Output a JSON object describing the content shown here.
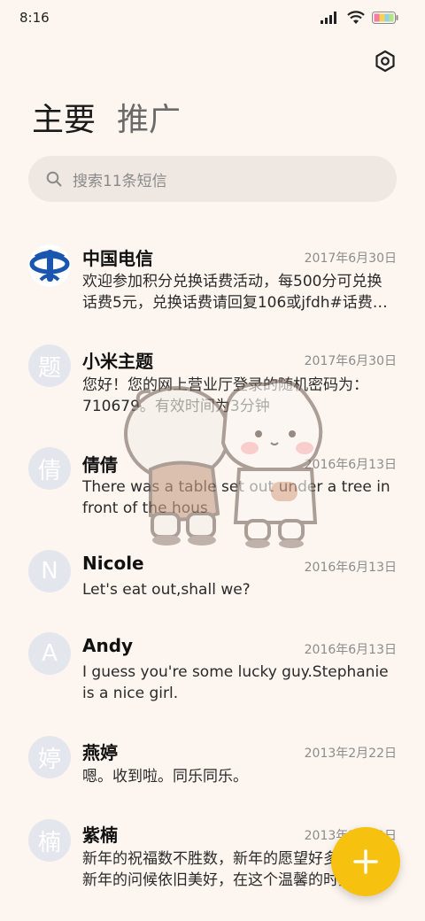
{
  "status_bar": {
    "time": "8:16",
    "icons": [
      "signal-icon",
      "wifi-icon",
      "battery-icon"
    ]
  },
  "header": {
    "settings_icon": "settings-hexagon-icon"
  },
  "tabs": [
    {
      "label": "主要",
      "active": true
    },
    {
      "label": "推广",
      "active": false
    }
  ],
  "search": {
    "placeholder": "搜索11条短信",
    "icon": "search-icon"
  },
  "messages": [
    {
      "avatar_text": "",
      "avatar_icon": "china-telecom-logo",
      "name": "中国电信",
      "date": "2017年6月30日",
      "preview": [
        "欢迎参加积分兑换话费活动，每500分可兑换",
        "话费5元，兑换话费请回复106或jfdh#话费…"
      ]
    },
    {
      "avatar_text": "题",
      "name": "小米主题",
      "date": "2017年6月30日",
      "preview": [
        "您好！您的网上营业厅登录的随机密码为：",
        "710679。有效时间为3分钟"
      ]
    },
    {
      "avatar_text": "倩",
      "name": "倩倩",
      "date": "2016年6月13日",
      "preview": [
        "There was a table set out under a tree in",
        "front of the hous"
      ]
    },
    {
      "avatar_text": "N",
      "name": "Nicole",
      "date": "2016年6月13日",
      "preview": [
        "Let's eat out,shall we?"
      ]
    },
    {
      "avatar_text": "A",
      "name": "Andy",
      "date": "2016年6月13日",
      "preview": [
        "I guess you're some lucky guy.Stephanie",
        "is a nice girl."
      ]
    },
    {
      "avatar_text": "婷",
      "name": "燕婷",
      "date": "2013年2月22日",
      "preview": [
        "嗯。收到啦。同乐同乐。"
      ]
    },
    {
      "avatar_text": "楠",
      "name": "紫楠",
      "date": "2013年2月22日",
      "preview": [
        "新年的祝福数不胜数，新年的愿望好多好多，",
        "新年的问候依旧美好，在这个温馨的时刻"
      ]
    }
  ],
  "fab": {
    "icon": "plus-icon",
    "color": "#f6c20f"
  }
}
